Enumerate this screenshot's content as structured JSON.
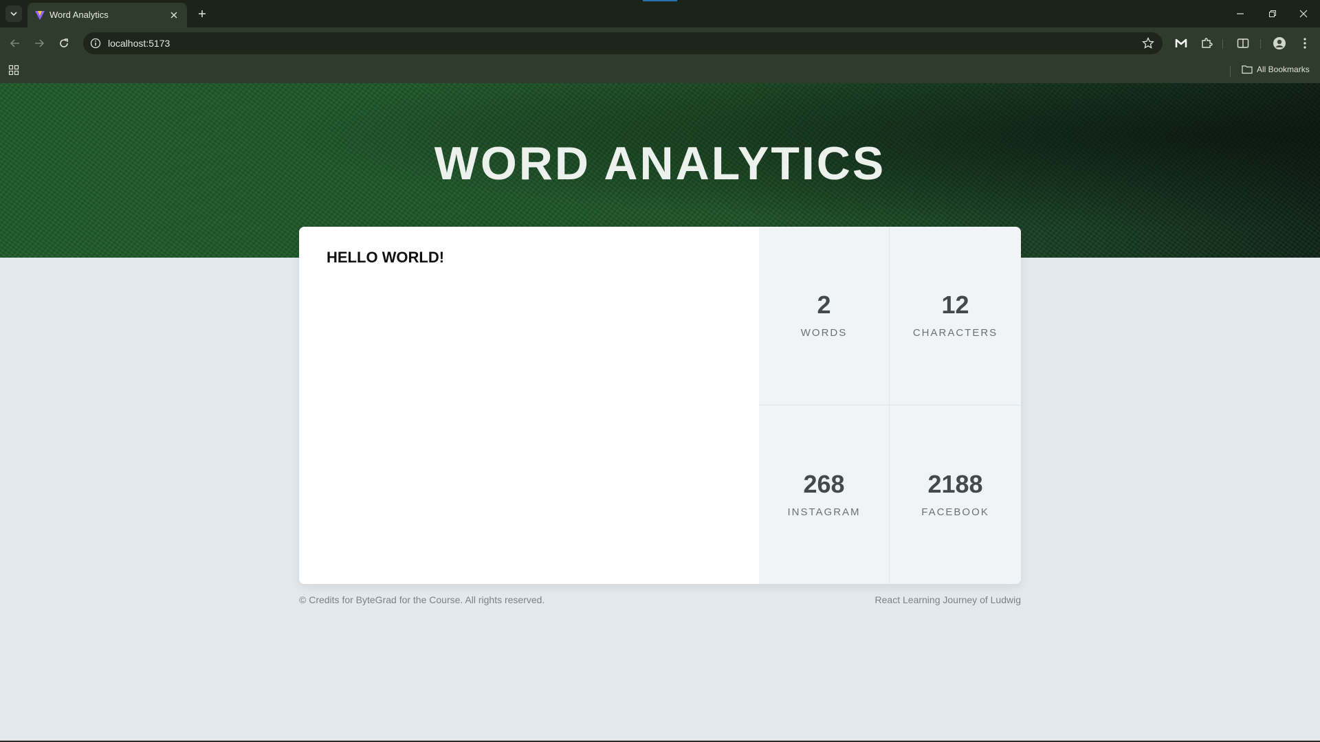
{
  "browser": {
    "tab_title": "Word Analytics",
    "url": "localhost:5173",
    "all_bookmarks_label": "All Bookmarks"
  },
  "page": {
    "title_bold": "WORD",
    "title_light": "ANALYTICS",
    "textarea_value": "HELLO WORLD!",
    "stats": [
      {
        "number": "2",
        "label": "WORDS"
      },
      {
        "number": "12",
        "label": "CHARACTERS"
      },
      {
        "number": "268",
        "label": "INSTAGRAM"
      },
      {
        "number": "2188",
        "label": "FACEBOOK"
      }
    ],
    "footer_left": "© Credits for ByteGrad for the Course. All rights reserved.",
    "footer_right": "React Learning Journey of Ludwig"
  },
  "colors": {
    "hero_green": "#1f5b2a",
    "page_background": "#e2e8ec",
    "stats_background": "#f0f4f6"
  }
}
